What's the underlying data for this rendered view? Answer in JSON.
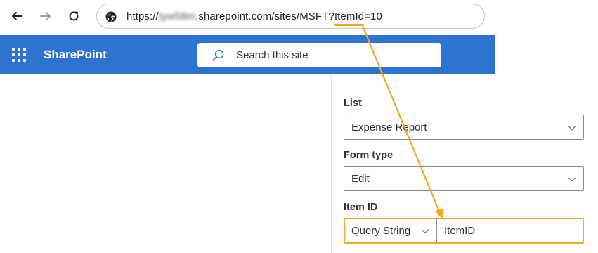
{
  "browser": {
    "url_prefix": "https://",
    "url_blurred": "tyw58m",
    "url_domain": ".sharepoint.com/sites/MSFT?",
    "url_param_name": "ItemId",
    "url_param_value": "=10"
  },
  "suite_bar": {
    "brand": "SharePoint",
    "search_placeholder": "Search this site",
    "color": "#2f73d1"
  },
  "panel": {
    "list_label": "List",
    "list_value": "Expense Report",
    "form_type_label": "Form type",
    "form_type_value": "Edit",
    "item_id_label": "Item ID",
    "item_id_source": "Query String",
    "item_id_value": "ItemID"
  },
  "annotation": {
    "highlight_color": "#f2a81d"
  }
}
